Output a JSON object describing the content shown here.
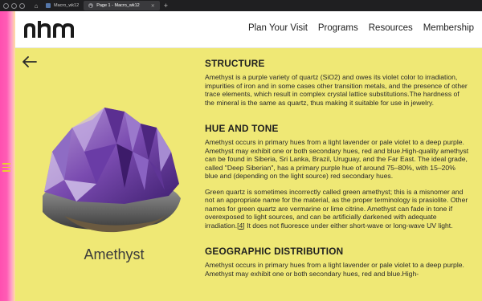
{
  "window": {
    "tabs": [
      {
        "label": "Macro_wk12",
        "active": false
      },
      {
        "label": "Page 1 - Macro_wk12",
        "active": true
      }
    ]
  },
  "header": {
    "logo_text": "nhm",
    "nav": [
      "Plan Your Visit",
      "Programs",
      "Resources",
      "Membership"
    ]
  },
  "specimen": {
    "name": "Amethyst",
    "icon": "amethyst-crystal-image"
  },
  "sections": [
    {
      "heading": "STRUCTURE",
      "paragraphs": [
        "Amethyst is a purple variety of quartz (SiO2) and owes its violet color to irradiation, impurities of iron and in some cases other transition metals, and the presence of other trace elements, which result in complex crystal lattice substitutions.The hardness of the mineral is the same as quartz, thus making it suitable for use in jewelry."
      ]
    },
    {
      "heading": "HUE AND TONE",
      "paragraphs": [
        "Amethyst occurs in primary hues from a light lavender or pale violet to a deep purple. Amethyst may exhibit one or both secondary hues, red and blue.High-quality amethyst can be found in Siberia, Sri Lanka, Brazil, Uruguay, and the Far East. The ideal grade, called \"Deep Siberian\", has a primary purple hue of around 75–80%, with 15–20% blue and (depending on the light source) red secondary hues.",
        "Green quartz is sometimes incorrectly called green amethyst; this is a misnomer and not an appropriate name for the material, as the proper terminology is prasiolite. Other names for green quartz are vermarine or lime citrine. Amethyst can fade in tone if overexposed to light sources, and can be artificially darkened with adequate irradiation."
      ],
      "reference": "[4]",
      "after_reference": " It does not fluoresce under either short-wave or long-wave UV light."
    },
    {
      "heading": "GEOGRAPHIC DISTRIBUTION",
      "paragraphs": [
        "Amethyst occurs in primary hues from a light lavender or pale violet to a deep purple. Amethyst may exhibit one or both secondary hues, red and blue.High-"
      ]
    }
  ],
  "colors": {
    "page_bg": "#efe875",
    "strip": "#ff4fb0",
    "header_bg": "#ffffff",
    "text": "#2a2a2a"
  }
}
